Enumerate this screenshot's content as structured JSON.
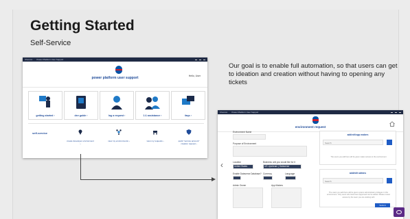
{
  "slide": {
    "title": "Getting Started",
    "subtitle": "Self-Service",
    "description": "Our goal is to enable full automation, so that users can get to ideation and creation without having to opening any tickets"
  },
  "portal": {
    "window_title_left": "Chevron",
    "window_title_right": "Power Platform User Support",
    "brand": "power platform user support",
    "user": "Hello, User",
    "tiles": [
      {
        "label": "getting started ›",
        "icon": "person-at-board-icon"
      },
      {
        "label": "dev guide ›",
        "icon": "book-icon"
      },
      {
        "label": "log a request ›",
        "icon": "headset-user-icon"
      },
      {
        "label": "1:1 assistance ›",
        "icon": "meeting-icon"
      },
      {
        "label": "faqs ›",
        "icon": "chat-bubble-icon"
      }
    ],
    "self_service": {
      "label": "self-service",
      "items": [
        {
          "label": "create developer environment ›",
          "icon": "location-pin-icon"
        },
        {
          "label": "view my environments ›",
          "icon": "network-icon"
        },
        {
          "label": "view my requests ›",
          "icon": "cart-icon"
        },
        {
          "label": "quick \"service account\" creation request ›",
          "icon": "shield-icon"
        }
      ]
    }
  },
  "request": {
    "window_title_left": "Chevron",
    "window_title_right": "Power Platform User Support",
    "brand": "environment request",
    "fields": {
      "env_name": "Environment Name",
      "purpose": "Purpose of Environment",
      "location": "Location",
      "location_value": "United States",
      "business_unit": "Business unit you would like for it",
      "business_unit_value": "US Upstream | Dataverse",
      "dataverse": "Enable Dataverse Database?",
      "currency": "Currency",
      "language": "Language",
      "admin_owner": "Admin Owner",
      "app_makers": "App Makers"
    },
    "panels": {
      "makers_title": "add/edit app makers",
      "makers_placeholder": "Search",
      "makers_note": "The users you add here will be given maker access to the environment",
      "admins_title": "add/edit admins",
      "admins_placeholder": "Search",
      "admins_note": "The users you add here will be given system administrator privileges in this environment. Only users who have been approved can be added. Please review access by the team you are working with"
    },
    "submit_label": "Submit"
  }
}
